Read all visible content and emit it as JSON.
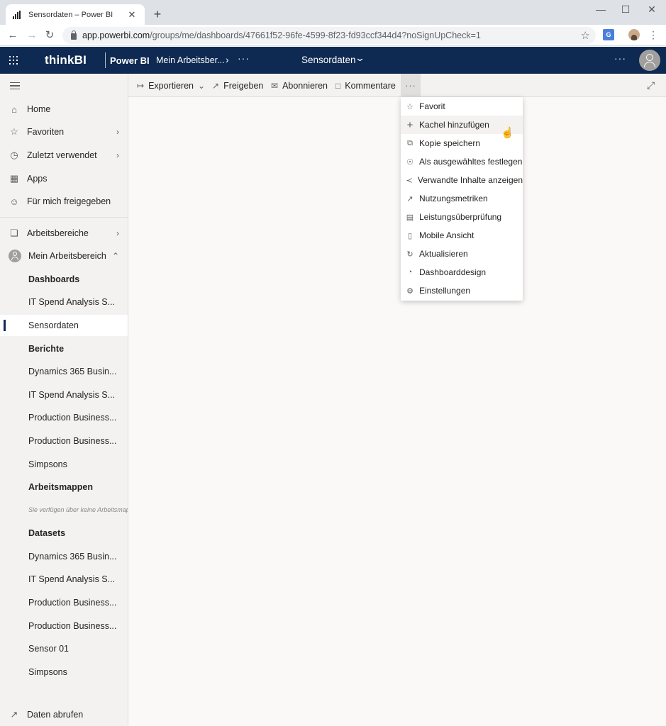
{
  "browser": {
    "tab_title": "Sensordaten – Power BI",
    "tab_close": "✕",
    "new_tab": "+",
    "url_main": "app.powerbi.com",
    "url_rest": "/groups/me/dashboards/47661f52-96fe-4599-8f23-fd93ccf344d4?noSignUpCheck=1",
    "translate_icon": "G",
    "icons": [
      "back-icon",
      "forward-icon",
      "reload-icon",
      "lock-icon",
      "bookmark-star-icon",
      "translate-icon",
      "profile-icon",
      "kebab-menu-icon",
      "minimize-icon",
      "maximize-icon",
      "close-icon"
    ]
  },
  "header": {
    "brand": "thinkBI",
    "product": "Power BI",
    "workspace": "Mein Arbeitsber...",
    "more": "···",
    "title": "Sensordaten",
    "colors": {
      "bar": "#0e2a52"
    }
  },
  "nav": {
    "items": [
      {
        "label": "Home"
      },
      {
        "label": "Favoriten"
      },
      {
        "label": "Zuletzt verwendet"
      },
      {
        "label": "Apps"
      },
      {
        "label": "Für mich freigegeben"
      },
      {
        "label": "Arbeitsbereiche"
      },
      {
        "label": "Mein Arbeitsbereich"
      }
    ],
    "sections": {
      "dashboards": "Dashboards",
      "dashboard_items": [
        "IT Spend Analysis S...",
        "Sensordaten"
      ],
      "reports": "Berichte",
      "report_items": [
        "Dynamics 365 Busin...",
        "IT Spend Analysis S...",
        "Production Business...",
        "Production Business...",
        "Simpsons"
      ],
      "workbooks": "Arbeitsmappen",
      "workbooks_empty": "Sie verfügen über keine Arbeitsmappen",
      "datasets": "Datasets",
      "dataset_items": [
        "Dynamics 365 Busin...",
        "IT Spend Analysis S...",
        "Production Business...",
        "Production Business...",
        "Sensor 01",
        "Simpsons"
      ]
    },
    "get_data": "Daten abrufen"
  },
  "toolbar": {
    "export": "Exportieren",
    "share": "Freigeben",
    "subscribe": "Abonnieren",
    "comments": "Kommentare",
    "more": "···"
  },
  "menu": {
    "items": [
      {
        "label": "Favorit",
        "icon": "star-icon"
      },
      {
        "label": "Kachel hinzufügen",
        "icon": "plus-icon"
      },
      {
        "label": "Kopie speichern",
        "icon": "copy-icon"
      },
      {
        "label": "Als ausgewähltes festlegen",
        "icon": "featured-icon"
      },
      {
        "label": "Verwandte Inhalte anzeigen",
        "icon": "related-icon"
      },
      {
        "label": "Nutzungsmetriken",
        "icon": "metrics-icon"
      },
      {
        "label": "Leistungsüberprüfung",
        "icon": "performance-icon"
      },
      {
        "label": "Mobile Ansicht",
        "icon": "mobile-icon"
      },
      {
        "label": "Aktualisieren",
        "icon": "refresh-icon"
      },
      {
        "label": "Dashboarddesign",
        "icon": "palette-icon"
      },
      {
        "label": "Einstellungen",
        "icon": "settings-icon"
      }
    ]
  }
}
